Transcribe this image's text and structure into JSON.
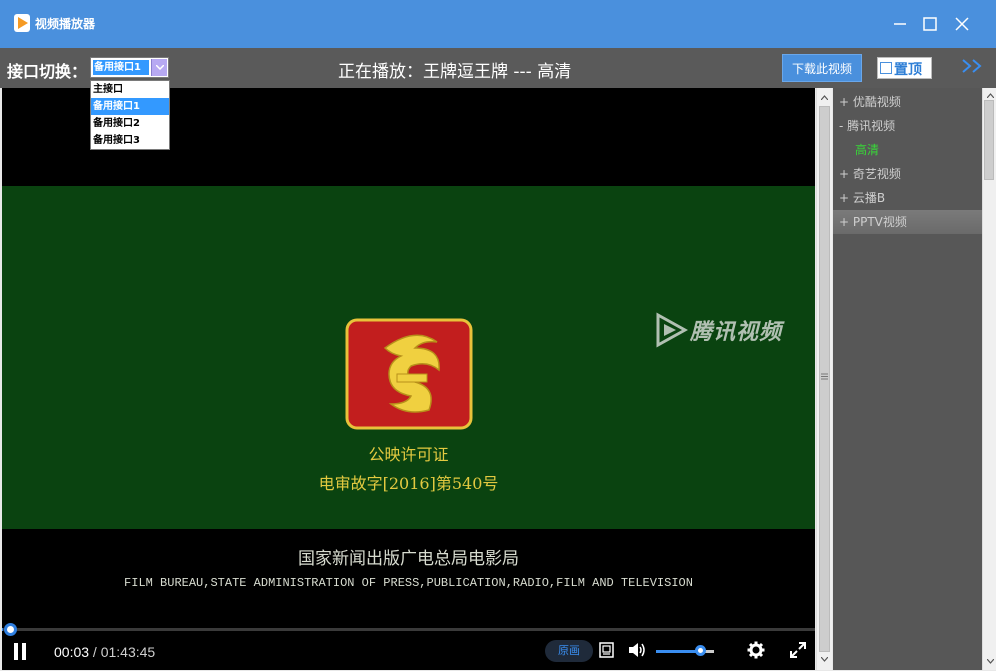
{
  "window": {
    "title": "视频播放器",
    "icon": "play-logo-icon",
    "controls": [
      "minimize-icon",
      "maximize-icon",
      "close-icon"
    ]
  },
  "toolbar": {
    "interface_label": "接口切换：",
    "interface_selected": "备用接口1",
    "interface_options": [
      "主接口",
      "备用接口1",
      "备用接口2",
      "备用接口3"
    ],
    "now_playing": "正在播放：王牌逗王牌  ---  高清",
    "download_label": "下载此视频",
    "pin_label": "置顶",
    "pin_checked": false,
    "collapse_label": ">>"
  },
  "video": {
    "watermark": "腾讯视频",
    "license_title": "公映许可证",
    "license_number": "电审故字[2016]第540号",
    "bureau_cn": "国家新闻出版广电总局电影局",
    "bureau_en": "FILM BUREAU,STATE ADMINISTRATION OF PRESS,PUBLICATION,RADIO,FILM AND TELEVISION"
  },
  "player": {
    "current_time": "00:03",
    "separator": " / ",
    "duration": "01:43:45",
    "progress_fraction": 0.0005,
    "quality_label": "原画",
    "volume_fraction": 0.75,
    "icons": [
      "pause-icon",
      "picture-in-picture-icon",
      "volume-icon",
      "settings-gear-icon",
      "fullscreen-icon"
    ]
  },
  "sidebar": {
    "sources": [
      {
        "label": "+ 优酷视频",
        "expanded": false
      },
      {
        "label": "- 腾讯视频",
        "expanded": true,
        "children": [
          "高清"
        ]
      },
      {
        "label": "+ 奇艺视频",
        "expanded": false
      },
      {
        "label": "+ 云播B",
        "expanded": false
      },
      {
        "label": "+ PPTV视频",
        "expanded": false,
        "highlighted": true
      }
    ]
  },
  "colors": {
    "titlebar": "#4a90dd",
    "toolbar": "#5a5a5a",
    "sidebar": "#575757",
    "accent": "#3a8ef0",
    "film_green": "#0a4310",
    "license_gold": "#e2c940",
    "quality_green": "#38d838"
  }
}
